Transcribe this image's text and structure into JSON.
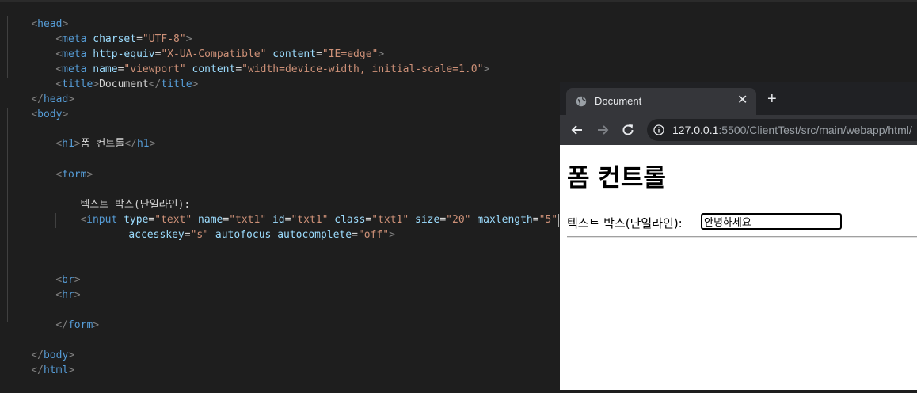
{
  "editor": {
    "lines": [
      "<head>",
      "<meta charset=\"UTF-8\">",
      "<meta http-equiv=\"X-UA-Compatible\" content=\"IE=edge\">",
      "<meta name=\"viewport\" content=\"width=device-width, initial-scale=1.0\">",
      "<title>Document</title>",
      "</head>",
      "<body>",
      "<h1>폼 컨트롤</h1>",
      "<form>",
      "텍스트 박스(단일라인):",
      "<input type=\"text\" name=\"txt1\" id=\"txt1\" class=\"txt1\" size=\"20\" maxlength=\"5\"",
      "accesskey=\"s\" autofocus autocomplete=\"off\">",
      "<br>",
      "<hr>",
      "</form>",
      "</body>",
      "</html>"
    ]
  },
  "browser": {
    "tab_title": "Document",
    "url_host": "127.0.0.1",
    "url_path": ":5500/ClientTest/src/main/webapp/html/",
    "page": {
      "heading": "폼 컨트롤",
      "textbox_label": "텍스트 박스(단일라인):",
      "textbox_value": "안녕하세요"
    }
  },
  "colors": {
    "editor_bg": "#1e1e1e",
    "tag": "#569cd6",
    "attr": "#9cdcfe",
    "string": "#ce9178",
    "tab_active": "#35363a",
    "titlebar": "#202124"
  }
}
